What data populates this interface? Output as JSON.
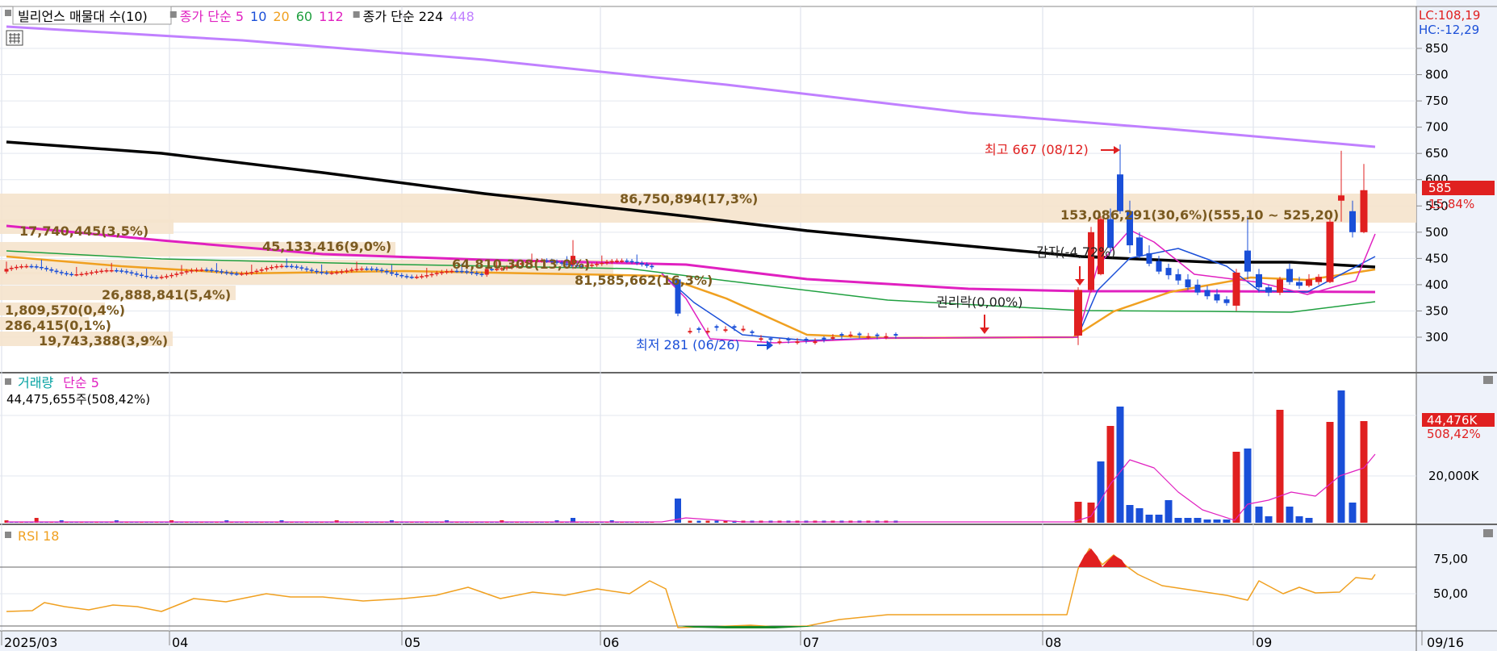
{
  "legend": {
    "main": [
      {
        "text": "빌리언스 매물대 수(10)",
        "color": "#000000"
      },
      {
        "text": "종가 단순 5",
        "color": "#e020c0"
      },
      {
        "text": "10",
        "color": "#1a4fd8"
      },
      {
        "text": "20",
        "color": "#f0a020"
      },
      {
        "text": "60",
        "color": "#20a040"
      },
      {
        "text": "112",
        "color": "#e020c0"
      },
      {
        "text": "종가 단순 224",
        "color": "#000000"
      },
      {
        "text": "448",
        "color": "#c080ff"
      }
    ],
    "volume": [
      {
        "text": "거래량",
        "color": "#00a0a0"
      },
      {
        "text": "단순 5",
        "color": "#e020c0"
      }
    ],
    "volume_summary": "44,475,655주(508,42%)",
    "rsi": "RSI 18"
  },
  "price_axis": {
    "lc": "LC:108,19",
    "hc": "HC:-12,29",
    "ticks": [
      "850",
      "800",
      "750",
      "700",
      "650",
      "600",
      "550",
      "500",
      "450",
      "400",
      "350",
      "300"
    ],
    "current": "585",
    "current_pct": "15,84%"
  },
  "volume_axis": {
    "ticks": [
      "20,000K"
    ],
    "current": "44,476K",
    "current_pct": "508,42%"
  },
  "rsi_axis": {
    "ticks": [
      "75,00",
      "50,00"
    ]
  },
  "date_axis": {
    "labels": [
      "2025/03",
      "04",
      "05",
      "06",
      "07",
      "08",
      "09"
    ],
    "last": "09/16"
  },
  "annotations": {
    "high": "최고 667 (08/12)",
    "low": "최저 281 (06/26)",
    "rights": "권리락(0,00%)",
    "other": "감자(-4,72%)"
  },
  "volume_profile": [
    {
      "label": "86,750,894(17,3%)",
      "price_range": [
        525,
        555
      ]
    },
    {
      "label": "153,086,291(30,6%)(555,10 ~ 525,20)",
      "price_range": [
        525,
        555
      ]
    },
    {
      "label": "17,740,445(3,5%)",
      "price_range": [
        495,
        510
      ]
    },
    {
      "label": "45,133,416(9,0%)",
      "price_range": [
        465,
        480
      ]
    },
    {
      "label": "64,810,308(13,0%)",
      "price_range": [
        435,
        450
      ]
    },
    {
      "label": "81,585,662(16,3%)",
      "price_range": [
        420,
        435
      ]
    },
    {
      "label": "26,888,841(5,4%)",
      "price_range": [
        405,
        420
      ]
    },
    {
      "label": "1,809,570(0,4%)",
      "price_range": [
        375,
        390
      ]
    },
    {
      "label": "286,415(0,1%)",
      "price_range": [
        360,
        375
      ]
    },
    {
      "label": "19,743,388(3,9%)",
      "price_range": [
        345,
        360
      ]
    }
  ],
  "chart_data": [
    {
      "type": "candlestick",
      "ylim": [
        250,
        880
      ],
      "series": [
        {
          "name": "종가 단순 224",
          "color": "#000000"
        },
        {
          "name": "448",
          "color": "#c080ff"
        },
        {
          "name": "112",
          "color": "#e020c0"
        },
        {
          "name": "60",
          "color": "#20a040"
        },
        {
          "name": "20",
          "color": "#f0a020"
        },
        {
          "name": "10",
          "color": "#1a4fd8"
        },
        {
          "name": "종가 단순 5",
          "color": "#e020c0"
        }
      ],
      "high": 667,
      "low": 281,
      "last": 585
    },
    {
      "type": "bar",
      "series": [
        {
          "name": "거래량"
        },
        {
          "name": "단순 5"
        }
      ],
      "last": 44476
    },
    {
      "type": "line",
      "series": [
        {
          "name": "RSI 18"
        }
      ],
      "ylim": [
        30,
        90
      ],
      "levels": [
        70,
        30
      ]
    }
  ]
}
